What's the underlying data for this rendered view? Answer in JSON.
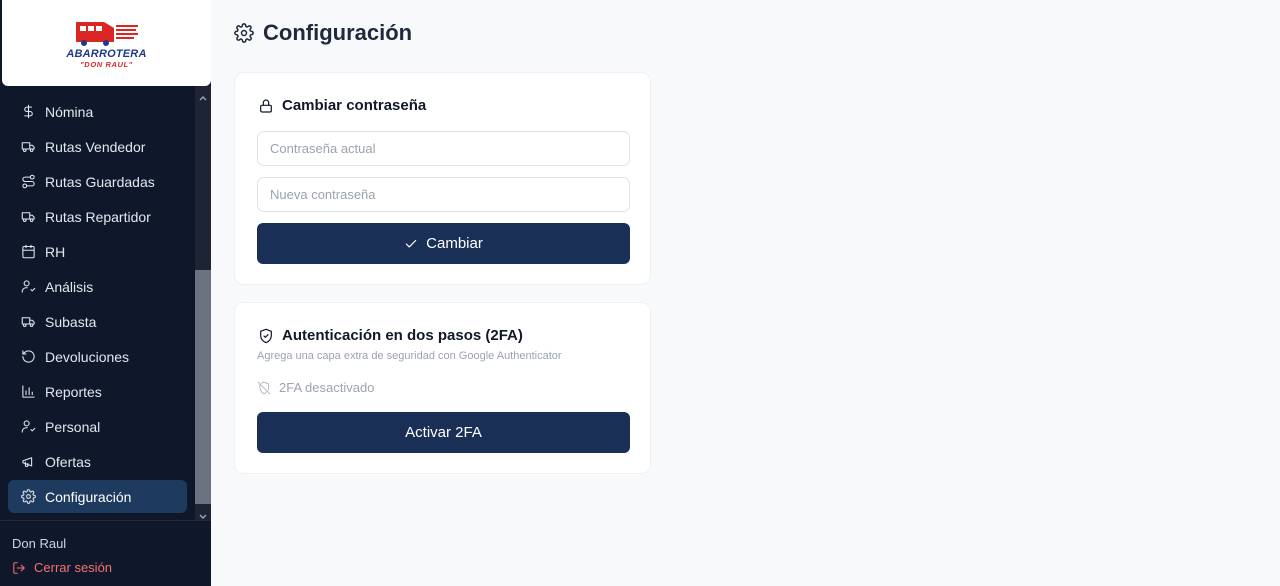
{
  "brand": {
    "name": "ABARROTERA",
    "tagline": "\"DON RAUL\"",
    "colors": {
      "red": "#dc2626",
      "blue": "#1e3a8a"
    }
  },
  "sidebar": {
    "items": [
      {
        "label": "Nómina",
        "icon": "dollar-icon"
      },
      {
        "label": "Rutas Vendedor",
        "icon": "truck-icon"
      },
      {
        "label": "Rutas Guardadas",
        "icon": "route-icon"
      },
      {
        "label": "Rutas Repartidor",
        "icon": "truck-icon"
      },
      {
        "label": "RH",
        "icon": "calendar-icon"
      },
      {
        "label": "Análisis",
        "icon": "user-check-icon"
      },
      {
        "label": "Subasta",
        "icon": "truck-icon"
      },
      {
        "label": "Devoluciones",
        "icon": "rotate-ccw-icon"
      },
      {
        "label": "Reportes",
        "icon": "bar-chart-icon"
      },
      {
        "label": "Personal",
        "icon": "user-check-icon"
      },
      {
        "label": "Ofertas",
        "icon": "megaphone-icon"
      },
      {
        "label": "Configuración",
        "icon": "gear-icon",
        "active": true
      }
    ],
    "user_name": "Don Raul",
    "logout_label": "Cerrar sesión"
  },
  "header": {
    "title": "Configuración",
    "icon": "gear-icon"
  },
  "password_card": {
    "title": "Cambiar contraseña",
    "current_placeholder": "Contraseña actual",
    "new_placeholder": "Nueva contraseña",
    "submit_label": "Cambiar"
  },
  "twofa_card": {
    "title": "Autenticación en dos pasos (2FA)",
    "subtitle": "Agrega una capa extra de seguridad con Google Authenticator",
    "status": "2FA desactivado",
    "activate_label": "Activar 2FA"
  },
  "colors": {
    "sidebar_bg": "#0f172a",
    "accent": "#1a2f55",
    "active_item": "#1e3a5f",
    "logout": "#f87171",
    "page_bg": "#f8f9fb"
  }
}
